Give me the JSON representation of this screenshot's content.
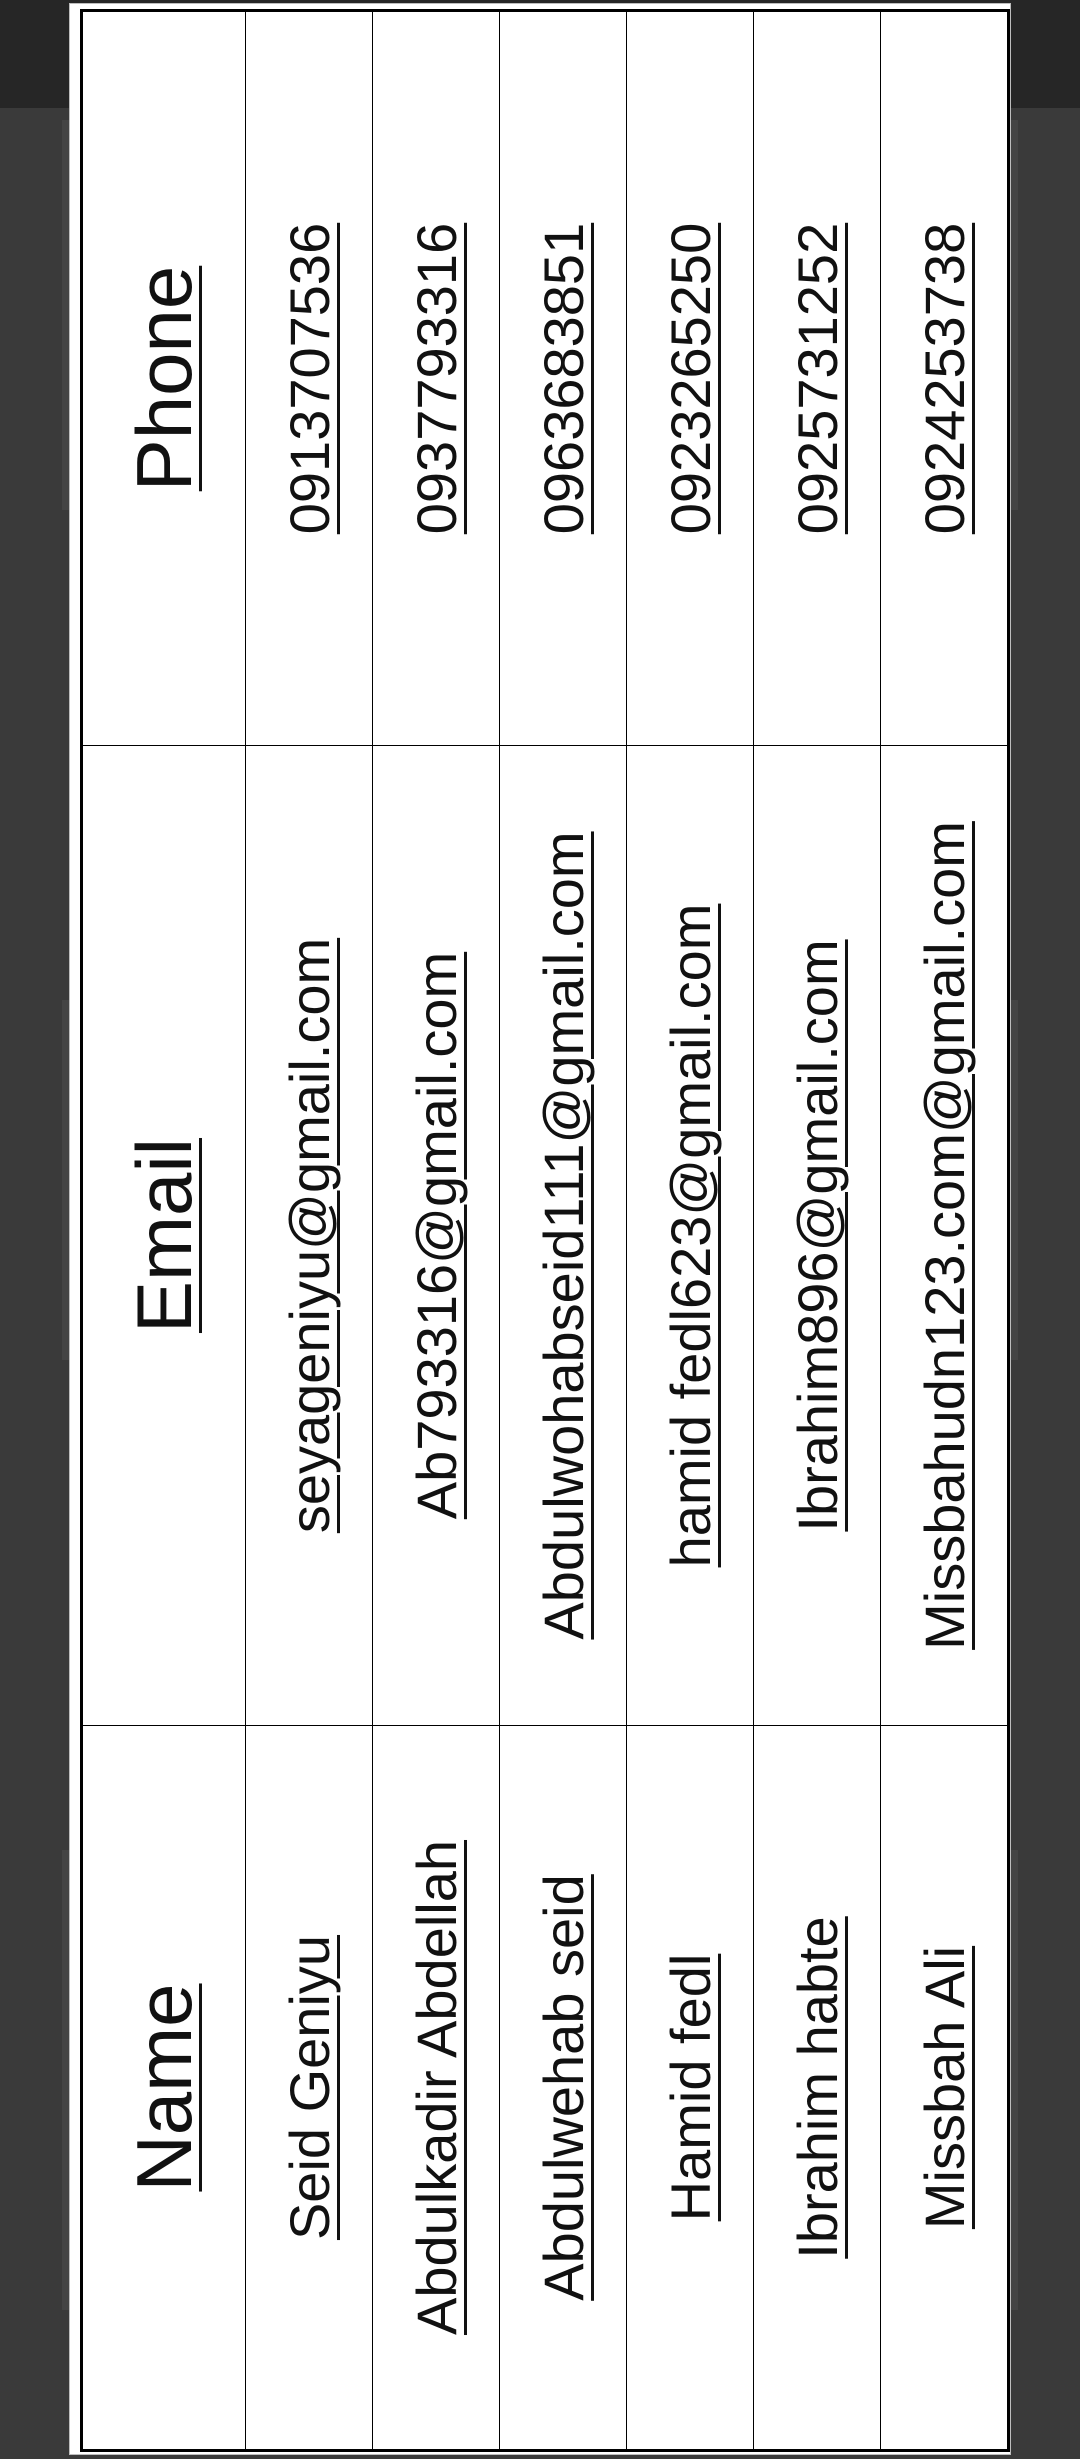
{
  "table": {
    "headers": [
      "Name",
      "Email",
      "Phone"
    ],
    "rows": [
      {
        "name": "Seid Geniyu",
        "email": "seyageniyu@gmail.com",
        "phone": "0913707536"
      },
      {
        "name": "Abdulkadir Abdellah",
        "email": "Ab793316@gmail.com",
        "phone": "0937793316"
      },
      {
        "name": "Abdulwehab seid",
        "email": "Abdulwohabseid111@gmail.com",
        "phone": "0963683851"
      },
      {
        "name": "Hamid fedl",
        "email": "hamid fedl623@gmail.com",
        "phone": "0923265250"
      },
      {
        "name": "Ibrahim habte",
        "email": "Ibrahim896@gmail.com",
        "phone": "0925731252"
      },
      {
        "name": "Missbah Ali",
        "email": "Missbahudn123.com@gmail.com",
        "phone": "0924253738"
      }
    ]
  },
  "colors": {
    "background": "#3a3a3a",
    "topbar": "#262626",
    "sheet": "#ffffff",
    "text": "#111111"
  }
}
